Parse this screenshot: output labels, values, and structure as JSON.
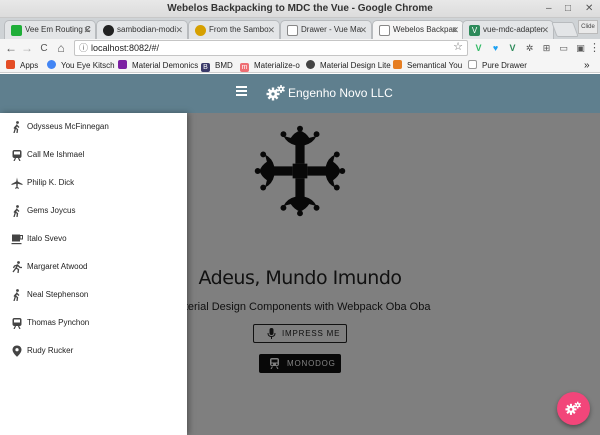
{
  "window": {
    "title": "Webelos Backpacking to MDC the Vue - Google Chrome",
    "minimize": "–",
    "maximize": "□",
    "close": "✕"
  },
  "tabs": [
    {
      "label": "Vee Em Routing C",
      "icon": "green-square-icon",
      "color": "#1fae38",
      "active": false
    },
    {
      "label": "sambodian-modi",
      "icon": "github-icon",
      "color": "#222222",
      "active": false
    },
    {
      "label": "From the Sambo",
      "icon": "biohazard-icon",
      "color": "#d6a000",
      "active": false
    },
    {
      "label": "Drawer - Vue Ma",
      "icon": "document-icon",
      "color": "#888888",
      "active": false
    },
    {
      "label": "Webelos Backpac",
      "icon": "document-icon",
      "color": "#888888",
      "active": true
    },
    {
      "label": "vue-mdc-adapter",
      "icon": "vue-icon",
      "color": "#2d8a5a",
      "active": false
    }
  ],
  "tab_close": "✕",
  "profile_label": "Clide",
  "toolbar": {
    "url": "localhost:8082/#/",
    "back": "←",
    "forward": "→",
    "reload": "C",
    "home": "⌂",
    "star": "☆",
    "menu": "⋮"
  },
  "bookmarks": [
    {
      "label": "Apps",
      "icon": "apps-grid-icon",
      "color": "#e44d26"
    },
    {
      "label": "You Eye Kitsch",
      "icon": "refresh-icon",
      "color": "#4285f4"
    },
    {
      "label": "Material Demonics",
      "icon": "purple-square-icon",
      "color": "#7b1fa2"
    },
    {
      "label": "BMD",
      "icon": "bmd-icon",
      "color": "#3a3a6a"
    },
    {
      "label": "Materialize-o",
      "icon": "materialize-icon",
      "color": "#ee6e73"
    },
    {
      "label": "Material Design Lite",
      "icon": "mdl-icon",
      "color": "#444444"
    },
    {
      "label": "Semantical You",
      "icon": "semantic-icon",
      "color": "#e67e22"
    },
    {
      "label": "Pure Drawer",
      "icon": "document-icon",
      "color": "#999999"
    }
  ],
  "bookmarks_more": "»",
  "app": {
    "brand": "Engenho Novo LLC",
    "headline": "Adeus, Mundo Imundo",
    "subline": "Material Design Components with Webpack Oba Oba",
    "impress_button": "IMPRESS ME",
    "monodog_button": "MONODOG",
    "accent_color": "#f2467a",
    "appbar_color": "#5f7f8e"
  },
  "drawer": {
    "items": [
      {
        "label": "Odysseus McFinnegan",
        "icon": "walk-icon"
      },
      {
        "label": "Call Me Ishmael",
        "icon": "train-icon"
      },
      {
        "label": "Philip K. Dick",
        "icon": "airplane-icon"
      },
      {
        "label": "Gems Joycus",
        "icon": "walk-icon"
      },
      {
        "label": "Italo Svevo",
        "icon": "coffee-icon"
      },
      {
        "label": "Margaret Atwood",
        "icon": "run-icon"
      },
      {
        "label": "Neal Stephenson",
        "icon": "walk-icon"
      },
      {
        "label": "Thomas Pynchon",
        "icon": "train-icon"
      },
      {
        "label": "Rudy Rucker",
        "icon": "place-pin-icon"
      }
    ]
  }
}
